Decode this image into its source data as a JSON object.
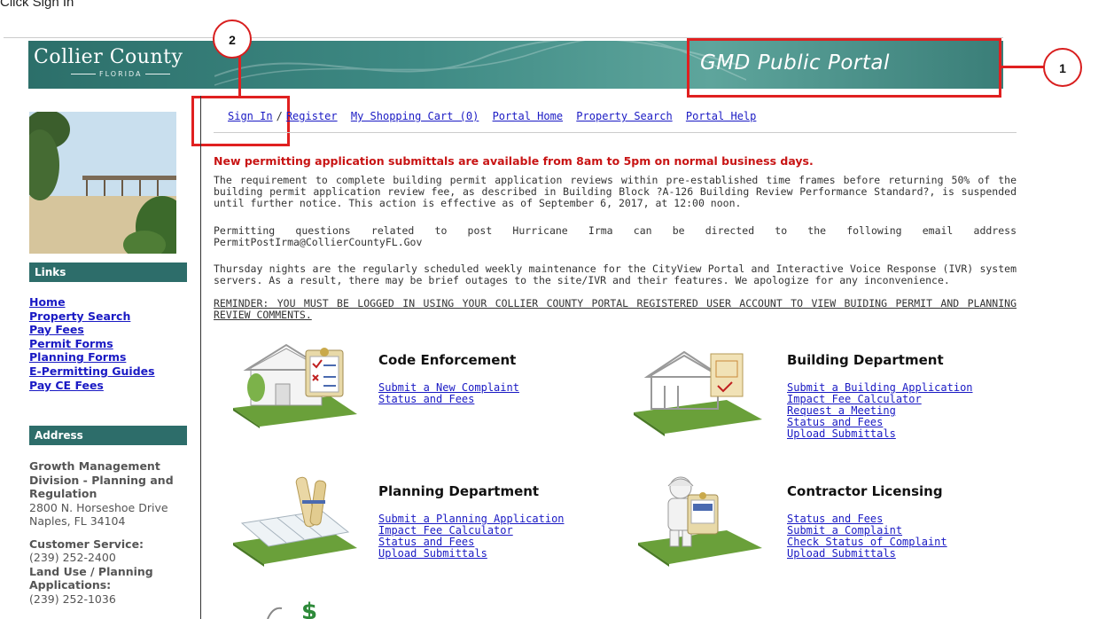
{
  "instruction": "Click Sign In",
  "header": {
    "logo_main": "Collier County",
    "logo_sub": "FLORIDA",
    "portal_title": "GMD Public Portal"
  },
  "callouts": {
    "one": "1",
    "two": "2"
  },
  "nav": {
    "sign_in": "Sign In",
    "separator": "/",
    "register": "Register",
    "cart": "My Shopping Cart (0)",
    "portal_home": "Portal Home",
    "property_search": "Property Search",
    "portal_help": "Portal Help"
  },
  "sidebar": {
    "links_heading": "Links",
    "links": [
      "Home",
      "Property Search",
      "Pay Fees",
      "Permit Forms",
      "Planning Forms",
      "E-Permitting Guides",
      "Pay CE Fees"
    ],
    "address_heading": "Address",
    "address": {
      "division": "Growth Management Division - Planning and Regulation",
      "street": "2800 N. Horseshoe Drive",
      "city": "Naples, FL 34104",
      "cs_label": "Customer Service:",
      "cs_phone": "(239) 252-2400",
      "landuse_label": "Land Use / Planning Applications:",
      "landuse_phone": "(239) 252-1036"
    }
  },
  "main": {
    "alert": "New permitting application submittals are available from 8am to 5pm on normal business days.",
    "p1": "The requirement to complete building permit application reviews within pre-established time frames before returning 50% of the building permit application review fee, as described in Building Block ?A-126 Building Review Performance Standard?, is suspended until further notice. This action is effective as of September 6, 2017, at 12:00 noon.",
    "p2": "Permitting questions related to post Hurricane Irma can be directed to the following email address PermitPostIrma@CollierCountyFL.Gov",
    "p3": "Thursday nights are the regularly scheduled weekly maintenance for the CityView Portal and Interactive Voice Response (IVR) system servers. As a result, there may be brief outages to the site/IVR and their features. We apologize for any inconvenience.",
    "reminder": "REMINDER: YOU MUST BE LOGGED IN USING YOUR COLLIER COUNTY PORTAL REGISTERED USER ACCOUNT TO VIEW BUIDING PERMIT AND PLANNING REVIEW COMMENTS."
  },
  "departments": {
    "code": {
      "title": "Code Enforcement",
      "links": [
        "Submit a New Complaint",
        "Status and Fees"
      ]
    },
    "building": {
      "title": "Building Department",
      "links": [
        "Submit a Building Application",
        "Impact Fee Calculator",
        "Request a Meeting",
        "Status and Fees",
        "Upload Submittals"
      ]
    },
    "planning": {
      "title": "Planning Department",
      "links": [
        "Submit a Planning Application",
        "Impact Fee Calculator",
        "Status and Fees",
        "Upload Submittals"
      ]
    },
    "contractor": {
      "title": "Contractor Licensing",
      "links": [
        "Status and Fees",
        "Submit a Complaint",
        "Check Status of Complaint",
        "Upload Submittals"
      ]
    }
  },
  "colors": {
    "accent": "#2d6d6a",
    "link": "#1a1ac4",
    "alert": "#c81414",
    "highlight_box": "#e02020"
  }
}
